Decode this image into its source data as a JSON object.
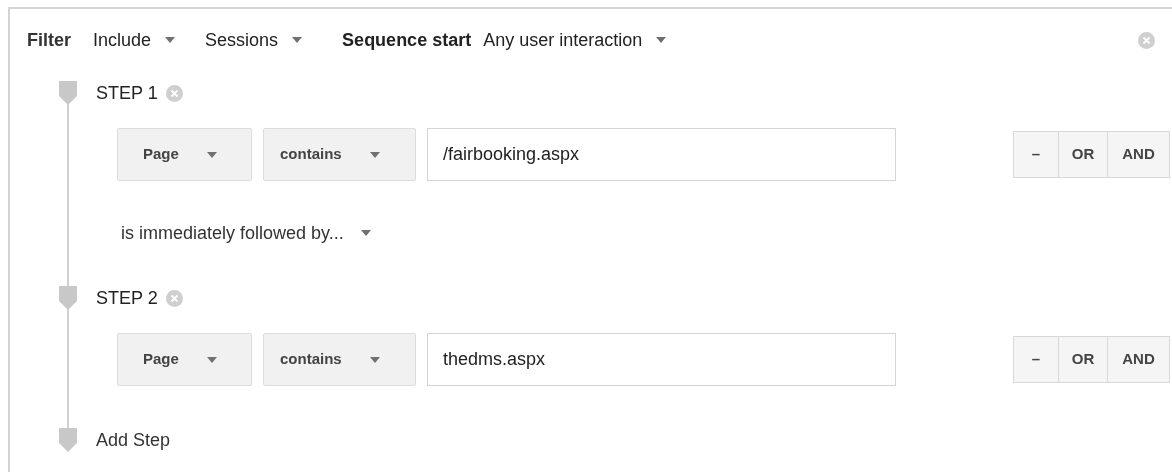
{
  "filter_bar": {
    "label": "Filter",
    "dropdowns": [
      "Include",
      "Sessions"
    ],
    "sequence_label": "Sequence start",
    "sequence_value": "Any user interaction"
  },
  "items": [
    {
      "kind": "step",
      "title": "STEP 1",
      "dimension": "Page",
      "operator": "contains",
      "value": "/fairbooking.aspx",
      "buttons": [
        "–",
        "OR",
        "AND"
      ]
    },
    {
      "kind": "connector",
      "label": "is immediately followed by..."
    },
    {
      "kind": "step",
      "title": "STEP 2",
      "dimension": "Page",
      "operator": "contains",
      "value": "thedms.aspx",
      "buttons": [
        "–",
        "OR",
        "AND"
      ]
    },
    {
      "kind": "add",
      "label": "Add Step"
    }
  ]
}
